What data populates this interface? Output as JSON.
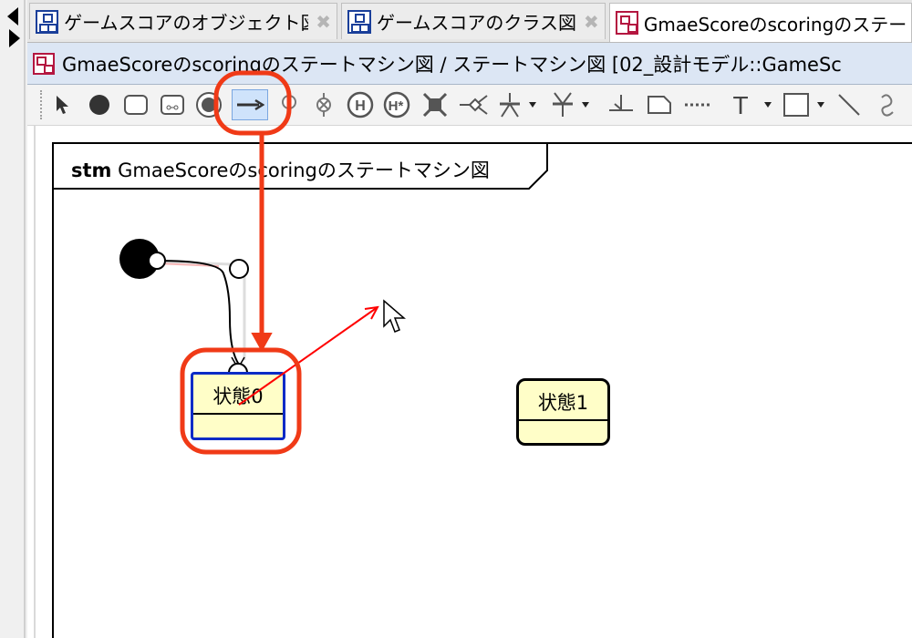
{
  "tabs": [
    {
      "label": "ゲームスコアのオブジェクト図",
      "icon": "object-diagram-icon"
    },
    {
      "label": "ゲームスコアのクラス図",
      "icon": "class-diagram-icon"
    },
    {
      "label": "GmaeScoreのscoringのステート",
      "icon": "state-machine-diagram-icon"
    }
  ],
  "title_bar": {
    "text": "GmaeScoreのscoringのステートマシン図 / ステートマシン図 [02_設計モデル::GameSc"
  },
  "toolbar": {
    "tools": [
      "select-tool-icon",
      "initial-state-icon",
      "state-icon",
      "submachine-state-icon",
      "final-state-icon",
      "transition-tool-icon",
      "entry-point-icon",
      "exit-point-icon",
      "shallow-history-icon",
      "deep-history-icon",
      "terminate-icon",
      "choice-icon",
      "fork-icon",
      "join-icon",
      "junction-icon",
      "note-icon",
      "note-connector-icon",
      "text-icon",
      "rectangle-icon",
      "line-icon",
      "freehand-icon"
    ],
    "selected_tool": "transition-tool-icon"
  },
  "diagram": {
    "frame_keyword": "stm",
    "frame_name": " GmaeScoreのscoringのステートマシン図",
    "states": [
      {
        "name": "状態0",
        "selected": true
      },
      {
        "name": "状態1",
        "selected": false
      }
    ]
  },
  "colors": {
    "annotation": "#f03a17",
    "state_fill": "#fffec8",
    "selection": "#0a2bc6"
  }
}
